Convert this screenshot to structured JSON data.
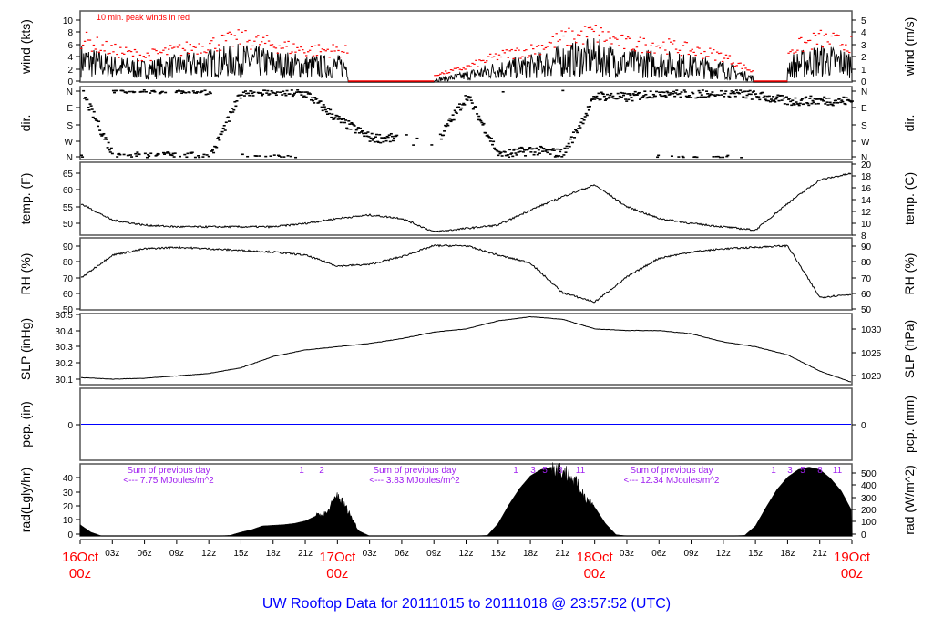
{
  "title": "UW Rooftop Data for 20111015  to  20111018 @ 23:57:52  (UTC)",
  "x_axis": {
    "hour_ticks": [
      "03z",
      "06z",
      "09z",
      "12z",
      "15z",
      "18z",
      "21z"
    ],
    "days": [
      {
        "day": "16Oct",
        "hr": "00z"
      },
      {
        "day": "17Oct",
        "hr": "00z"
      },
      {
        "day": "18Oct",
        "hr": "00z"
      },
      {
        "day": "19Oct",
        "hr": "00z"
      }
    ],
    "range_hours": [
      0,
      72
    ]
  },
  "colors": {
    "line": "#000000",
    "peak": "#ff0000",
    "precip": "#0000ff",
    "note": "#a020f0",
    "title": "#0000ff",
    "day": "#ff0000"
  },
  "chart_data": [
    {
      "type": "line",
      "id": "wind",
      "ylabel_left": "wind (kts)",
      "ylabel_right": "wind (m/s)",
      "ylim": [
        0,
        11.5
      ],
      "left_ticks": [
        "0",
        "2",
        "4",
        "6",
        "8",
        "10"
      ],
      "right_ticks": [
        "0",
        "1",
        "2",
        "3",
        "4",
        "5"
      ],
      "annotation": "10 min. peak winds in red",
      "x_hours": [
        0,
        3,
        6,
        9,
        12,
        15,
        18,
        21,
        24,
        27,
        30,
        33,
        36,
        39,
        42,
        45,
        48,
        51,
        54,
        57,
        60,
        63,
        66,
        69,
        72
      ],
      "mean_kts": [
        3.5,
        2.5,
        2,
        2.5,
        3,
        3.5,
        3,
        2.5,
        2.5,
        2,
        0,
        0.3,
        1,
        2,
        2.5,
        3.5,
        4,
        3,
        3,
        2.5,
        2,
        0.5,
        2.5,
        3.5,
        3
      ],
      "calm_periods_hours": [
        [
          25,
          33
        ],
        [
          62.8,
          66
        ]
      ]
    },
    {
      "type": "scatter",
      "id": "dir",
      "ylabel_left": "dir.",
      "ylabel_right": "dir.",
      "left_ticks": [
        "N",
        "W",
        "S",
        "E",
        "N"
      ],
      "right_ticks": [
        "N",
        "W",
        "S",
        "E",
        "N"
      ],
      "ylim": [
        0,
        360
      ],
      "x_hours": [
        0,
        3,
        6,
        9,
        12,
        15,
        18,
        21,
        24,
        27,
        30,
        33,
        36,
        39,
        42,
        45,
        48,
        51,
        54,
        57,
        60,
        63,
        66,
        69,
        72
      ],
      "dir_deg": [
        355,
        10,
        5,
        5,
        0,
        355,
        350,
        340,
        200,
        105,
        100,
        70,
        330,
        10,
        40,
        20,
        330,
        320,
        350,
        340,
        350,
        330,
        300,
        305,
        300
      ]
    },
    {
      "type": "line",
      "id": "temp",
      "ylabel_left": "temp. (F)",
      "ylabel_right": "temp. (C)",
      "ylim": [
        46.5,
        68.3
      ],
      "left_ticks": [
        "50",
        "55",
        "60",
        "65"
      ],
      "right_ticks": [
        "8",
        "10",
        "12",
        "14",
        "16",
        "18",
        "20"
      ],
      "x_hours": [
        0,
        3,
        6,
        9,
        12,
        15,
        18,
        21,
        24,
        27,
        30,
        33,
        36,
        39,
        42,
        45,
        48,
        51,
        54,
        57,
        60,
        63,
        66,
        69,
        72
      ],
      "values": [
        56,
        51,
        49.5,
        49,
        49,
        49,
        49,
        50,
        51.5,
        52.5,
        51.5,
        47.5,
        48.5,
        49.5,
        54,
        58,
        61.5,
        55,
        51.5,
        50,
        49,
        48,
        56,
        63,
        65
      ]
    },
    {
      "type": "line",
      "id": "rh",
      "ylabel_left": "RH (%)",
      "ylabel_right": "RH (%)",
      "ylim": [
        49,
        95
      ],
      "left_ticks": [
        "50",
        "60",
        "70",
        "80",
        "90"
      ],
      "right_ticks": [
        "50",
        "60",
        "70",
        "80",
        "90"
      ],
      "x_hours": [
        0,
        3,
        6,
        9,
        12,
        15,
        18,
        21,
        24,
        27,
        30,
        33,
        36,
        39,
        42,
        45,
        48,
        51,
        54,
        57,
        60,
        63,
        66,
        69,
        72
      ],
      "values": [
        69,
        84,
        88,
        89,
        88,
        87,
        86,
        84,
        77,
        78,
        83,
        90,
        90,
        84,
        79,
        60,
        54,
        70,
        82,
        86,
        88,
        89,
        90,
        57,
        59
      ]
    },
    {
      "type": "line",
      "id": "slp",
      "ylabel_left": "SLP (inHg)",
      "ylabel_right": "SLP (hPa)",
      "ylim": [
        30.066,
        30.505
      ],
      "left_ticks": [
        "30.1",
        "30.2",
        "30.3",
        "30.4",
        "30.5"
      ],
      "right_ticks": [
        "1020",
        "1025",
        "1030"
      ],
      "x_hours": [
        0,
        3,
        6,
        9,
        12,
        15,
        18,
        21,
        24,
        27,
        30,
        33,
        36,
        39,
        42,
        45,
        48,
        51,
        54,
        57,
        60,
        63,
        66,
        69,
        72
      ],
      "values": [
        30.11,
        30.1,
        30.105,
        30.12,
        30.135,
        30.17,
        30.24,
        30.28,
        30.3,
        30.32,
        30.35,
        30.39,
        30.41,
        30.46,
        30.485,
        30.47,
        30.41,
        30.4,
        30.4,
        30.38,
        30.33,
        30.3,
        30.25,
        30.15,
        30.08
      ]
    },
    {
      "type": "line",
      "id": "pcp",
      "ylabel_left": "pcp. (in)",
      "ylabel_right": "pcp. (mm)",
      "ylim": [
        -1,
        1
      ],
      "left_ticks": [
        "0"
      ],
      "right_ticks": [
        "0"
      ],
      "x_hours": [
        0,
        72
      ],
      "values": [
        0,
        0
      ]
    },
    {
      "type": "area",
      "id": "rad",
      "ylabel_left": "rad(Lgly/hr)",
      "ylabel_right": "rad (W/m^2)",
      "ylim": [
        0,
        575
      ],
      "left_ticks": [
        "0",
        "10",
        "20",
        "30",
        "40"
      ],
      "right_ticks": [
        "0",
        "100",
        "200",
        "300",
        "400",
        "500"
      ],
      "values_w_m2_hourly": [
        90,
        30,
        0,
        0,
        0,
        0,
        0,
        0,
        0,
        0,
        0,
        0,
        0,
        0,
        5,
        30,
        50,
        80,
        85,
        90,
        100,
        120,
        160,
        180,
        330,
        200,
        40,
        0,
        0,
        0,
        0,
        0,
        0,
        0,
        0,
        0,
        0,
        0,
        5,
        100,
        250,
        380,
        480,
        530,
        550,
        520,
        450,
        330,
        230,
        100,
        10,
        0,
        0,
        0,
        0,
        0,
        0,
        0,
        0,
        0,
        0,
        0,
        5,
        80,
        230,
        370,
        470,
        530,
        550,
        530,
        460,
        360,
        200
      ],
      "daily_sums": [
        {
          "label": "Sum of previous day",
          "value": "<--- 7.75 MJoules/m^2"
        },
        {
          "label": "Sum of previous day",
          "value": "<--- 3.83 MJoules/m^2"
        },
        {
          "label": "Sum of previous day",
          "value": "<--- 12.34 MJoules/m^2"
        }
      ],
      "hour_markers": [
        {
          "labels": [
            "1",
            "2"
          ]
        },
        {
          "labels": [
            "1",
            "3",
            "5",
            "8",
            "11"
          ]
        },
        {
          "labels": [
            "1",
            "3",
            "5",
            "8",
            "11"
          ]
        }
      ]
    }
  ]
}
